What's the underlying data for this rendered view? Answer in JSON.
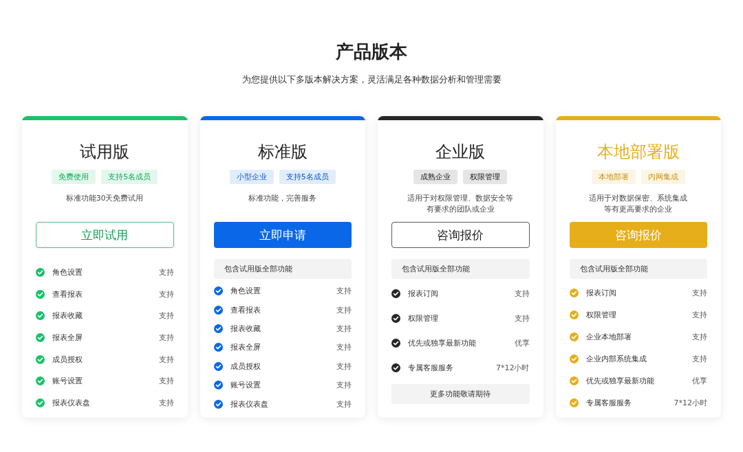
{
  "header": {
    "title": "产品版本",
    "subtitle": "为您提供以下多版本解决方案，灵活满足各种数据分析和管理需要"
  },
  "plans": [
    {
      "name": "试用版",
      "color": "#19c26b",
      "title_accent": false,
      "tags": [
        "免费使用",
        "支持5名成员"
      ],
      "description": [
        "标准功能30天免费试用"
      ],
      "button": {
        "label": "立即试用",
        "kind": "outline"
      },
      "features": [
        {
          "name": "角色设置",
          "value": "支持"
        },
        {
          "name": "查看报表",
          "value": "支持"
        },
        {
          "name": "报表收藏",
          "value": "支持"
        },
        {
          "name": "报表全屏",
          "value": "支持"
        },
        {
          "name": "成员授权",
          "value": "支持"
        },
        {
          "name": "账号设置",
          "value": "支持"
        },
        {
          "name": "报表仪表盘",
          "value": "支持"
        }
      ]
    },
    {
      "name": "标准版",
      "color": "#0a68e8",
      "title_accent": false,
      "tags": [
        "小型企业",
        "支持5名成员"
      ],
      "description": [
        "标准功能，完善服务"
      ],
      "button": {
        "label": "立即申请",
        "kind": "filled"
      },
      "included_note": "包含试用版全部功能",
      "features": [
        {
          "name": "角色设置",
          "value": "支持"
        },
        {
          "name": "查看报表",
          "value": "支持"
        },
        {
          "name": "报表收藏",
          "value": "支持"
        },
        {
          "name": "报表全屏",
          "value": "支持"
        },
        {
          "name": "成员授权",
          "value": "支持"
        },
        {
          "name": "账号设置",
          "value": "支持"
        },
        {
          "name": "报表仪表盘",
          "value": "支持"
        }
      ]
    },
    {
      "name": "企业版",
      "color": "#262626",
      "title_accent": false,
      "tags": [
        "成熟企业",
        "权限管理"
      ],
      "description": [
        "适用于对权限管理、数据安全等",
        "有要求的团队或企业"
      ],
      "button": {
        "label": "咨询报价",
        "kind": "outline"
      },
      "included_note": "包含试用版全部功能",
      "features": [
        {
          "name": "报表订阅",
          "value": "支持"
        },
        {
          "name": "权限管理",
          "value": "支持"
        },
        {
          "name": "优先或独享最新功能",
          "value": "优享"
        },
        {
          "name": "专属客服服务",
          "value": "7*12小时"
        }
      ],
      "footer_note": "更多功能敬请期待"
    },
    {
      "name": "本地部署版",
      "color": "#e6ae1a",
      "title_accent": true,
      "tags": [
        "本地部署",
        "内网集成"
      ],
      "description": [
        "适用于对数据保密、系统集成",
        "等有更高要求的企业"
      ],
      "button": {
        "label": "咨询报价",
        "kind": "filled"
      },
      "included_note": "包含试用版全部功能",
      "features": [
        {
          "name": "报表订阅",
          "value": "支持"
        },
        {
          "name": "权限管理",
          "value": "支持"
        },
        {
          "name": "企业本地部署",
          "value": "支持"
        },
        {
          "name": "企业内部系统集成",
          "value": "支持"
        },
        {
          "name": "优先或独享最新功能",
          "value": "优享"
        },
        {
          "name": "专属客服服务",
          "value": "7*12小时"
        }
      ]
    }
  ]
}
